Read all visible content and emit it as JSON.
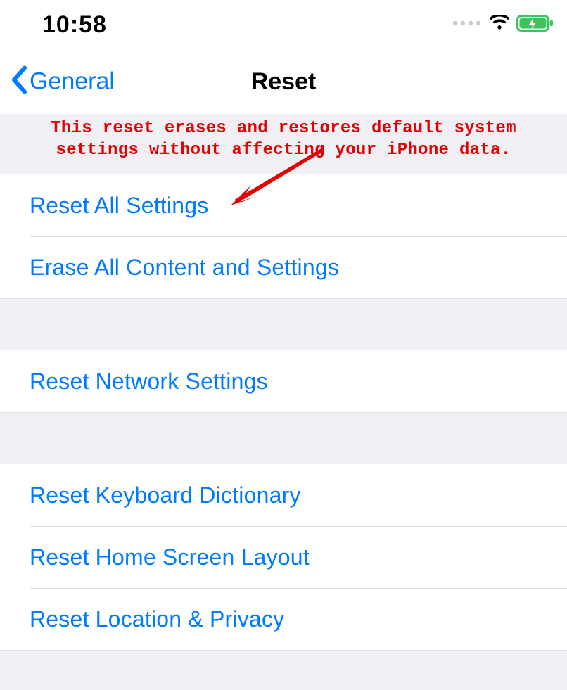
{
  "status": {
    "time": "10:58"
  },
  "nav": {
    "back_label": "General",
    "title": "Reset"
  },
  "annotation": {
    "text": "This reset erases and restores default system settings without affecting your iPhone data."
  },
  "groups": [
    {
      "items": [
        {
          "label": "Reset All Settings"
        },
        {
          "label": "Erase All Content and Settings"
        }
      ]
    },
    {
      "items": [
        {
          "label": "Reset Network Settings"
        }
      ]
    },
    {
      "items": [
        {
          "label": "Reset Keyboard Dictionary"
        },
        {
          "label": "Reset Home Screen Layout"
        },
        {
          "label": "Reset Location & Privacy"
        }
      ]
    }
  ],
  "colors": {
    "link": "#007aff",
    "annotation": "#e30000",
    "bg": "#efeff4",
    "battery": "#35c759"
  }
}
